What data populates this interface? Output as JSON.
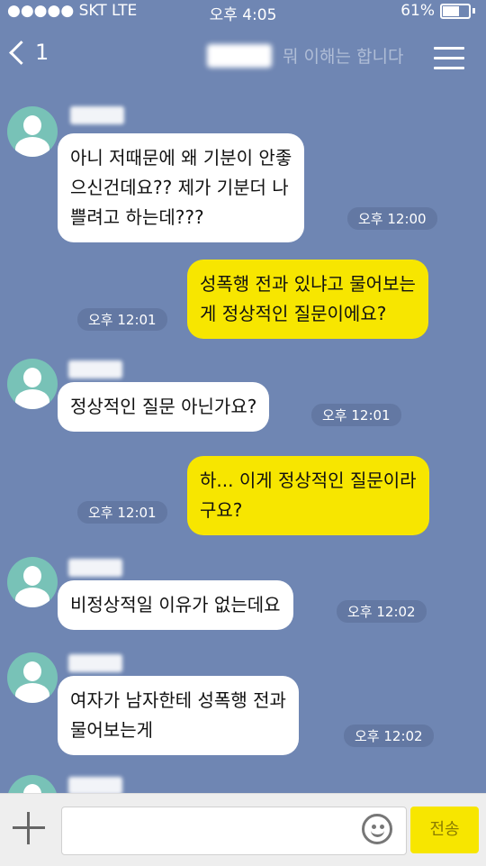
{
  "status": {
    "carrier": "●●●●● SKT  LTE",
    "time": "오후 4:05",
    "battery": "61%"
  },
  "header": {
    "back_count": "1",
    "subtitle": "뭐 이해는 합니다"
  },
  "messages": [
    {
      "side": "in",
      "text1": "아니 저때문에 왜 기분이 안좋",
      "text2": "으신건데요?? 제가 기분더 나",
      "text3": "쁠려고 하는데???",
      "time": "오후 12:00"
    },
    {
      "side": "out",
      "text1": "성폭행 전과 있냐고 물어보는",
      "text2": "게 정상적인 질문이에요?",
      "time": "오후 12:01"
    },
    {
      "side": "in",
      "text1": "정상적인 질문 아닌가요?",
      "time": "오후 12:01"
    },
    {
      "side": "out",
      "text1": "하... 이게 정상적인 질문이라",
      "text2": "구요?",
      "time": "오후 12:01"
    },
    {
      "side": "in",
      "text1": "비정상적일 이유가 없는데요",
      "time": "오후 12:02"
    },
    {
      "side": "in",
      "text1": "여자가 남자한테 성폭행 전과",
      "text2": "물어보는게",
      "time": "오후 12:02"
    }
  ],
  "input": {
    "placeholder": "",
    "send_label": "전송"
  }
}
